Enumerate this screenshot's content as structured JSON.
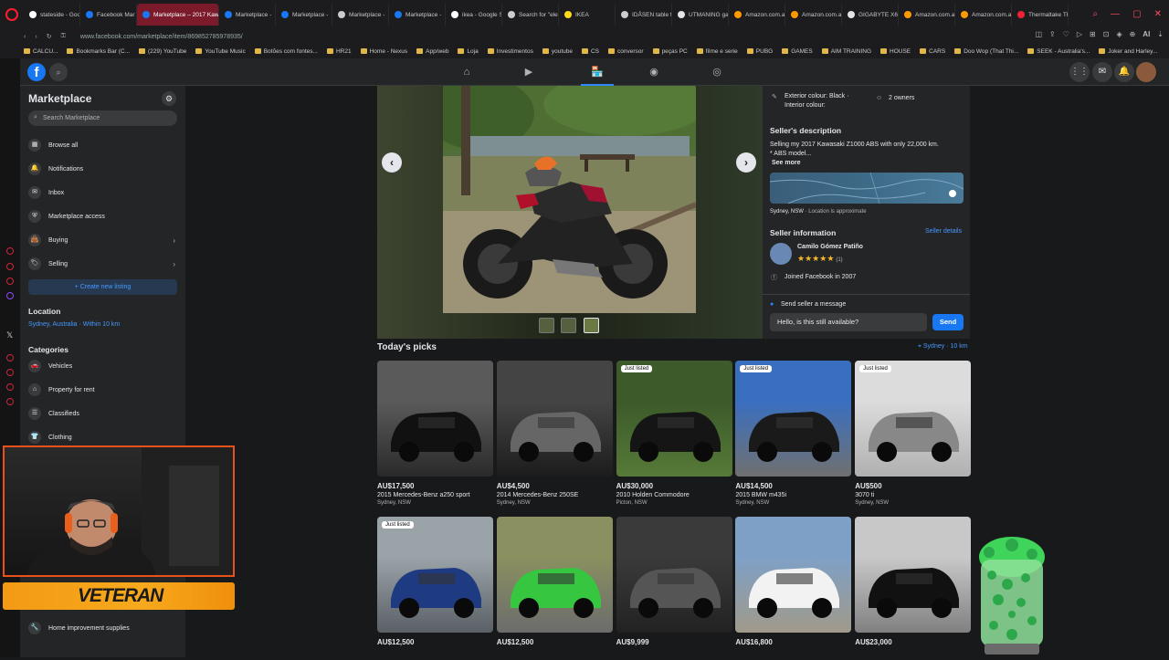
{
  "browser": {
    "tabs": [
      {
        "label": "stateside - Goo",
        "fav": "g"
      },
      {
        "label": "Facebook Mar",
        "fav": "fb"
      },
      {
        "label": "Marketplace – 2017 Kawa",
        "fav": "fb",
        "active": true
      },
      {
        "label": "Marketplace -",
        "fav": "fb"
      },
      {
        "label": "Marketplace -",
        "fav": "fb"
      },
      {
        "label": "Marketplace -",
        "fav": "doc"
      },
      {
        "label": "Marketplace -",
        "fav": "fb"
      },
      {
        "label": "ikea - Google S",
        "fav": "g"
      },
      {
        "label": "Search for \"ele",
        "fav": "doc"
      },
      {
        "label": "IKEA",
        "fav": "ikea"
      },
      {
        "label": "IDÅSEN table f",
        "fav": "doc"
      },
      {
        "label": "UTMANING ga",
        "fav": "ut"
      },
      {
        "label": "Amazon.com.a",
        "fav": "amz"
      },
      {
        "label": "Amazon.com.a",
        "fav": "amz"
      },
      {
        "label": "GIGABYTE X6",
        "fav": "ut"
      },
      {
        "label": "Amazon.com.a",
        "fav": "amz"
      },
      {
        "label": "Amazon.com.a",
        "fav": "amz"
      },
      {
        "label": "Thermaltake Th",
        "fav": "tt"
      }
    ],
    "url": "www.facebook.com/marketplace/item/869852785978935/",
    "ai_label": "AI",
    "bookmarks": [
      "CALCU...",
      "Bookmarks Bar (C...",
      "(229) YouTube",
      "YouTube Music",
      "Botões com fontes...",
      "HR21",
      "Home - Nexus",
      "App/web",
      "Loja",
      "Investimentos",
      "youtube",
      "CS",
      "conversor",
      "peças PC",
      "filme e serie",
      "PUBG",
      "GAMES",
      "AIM TRAINING",
      "HOUSE",
      "CARS",
      "Doo Wop (That Thi...",
      "SEEK - Australia's...",
      "Joker and Harley..."
    ]
  },
  "fb": {
    "logo": "f",
    "sidebar": {
      "title": "Marketplace",
      "search_placeholder": "Search Marketplace",
      "items": [
        {
          "label": "Browse all",
          "icon": "store-icon"
        },
        {
          "label": "Notifications",
          "icon": "bell-icon"
        },
        {
          "label": "Inbox",
          "icon": "inbox-icon"
        },
        {
          "label": "Marketplace access",
          "icon": "shield-icon"
        },
        {
          "label": "Buying",
          "icon": "bag-icon",
          "chevron": true
        },
        {
          "label": "Selling",
          "icon": "tag-icon",
          "chevron": true
        }
      ],
      "create_button": "+ Create new listing",
      "location_heading": "Location",
      "location_value": "Sydney, Australia · Within 10 km",
      "categories_heading": "Categories",
      "categories": [
        {
          "label": "Vehicles",
          "icon": "car-icon"
        },
        {
          "label": "Property for rent",
          "icon": "house-icon"
        },
        {
          "label": "Classifieds",
          "icon": "classifieds-icon"
        },
        {
          "label": "Clothing",
          "icon": "shirt-icon"
        }
      ],
      "bottom_category": "Home improvement supplies"
    },
    "details": {
      "exterior_colour": "Exterior colour: Black ·",
      "interior_colour": "Interior colour:",
      "owners": "2 owners",
      "description_heading": "Seller's description",
      "description_line1": "Selling my 2017 Kawasaki Z1000 ABS with only 22,000 km.",
      "description_line2": "* ABS model...",
      "see_more": "See more",
      "map_location": "Sydney, NSW",
      "map_note": " · Location is approximate",
      "seller_heading": "Seller information",
      "seller_details_link": "Seller details",
      "seller_name": "Camilo Gómez Patiño",
      "seller_rating": 5,
      "seller_rating_count": "(1)",
      "joined": "Joined Facebook in 2007",
      "send_message_label": "Send seller a message",
      "message_value": "Hello, is this still available?",
      "send_button": "Send"
    },
    "picks": {
      "heading": "Today's picks",
      "location": "Sydney · 10 km",
      "cards": [
        {
          "price": "AU$17,500",
          "title": "2015 Mercedes-Benz a250 sport",
          "location": "Sydney, NSW",
          "badge": "",
          "theme": "black-car-garage"
        },
        {
          "price": "AU$4,500",
          "title": "2014 Mercedes-Benz 250SE",
          "location": "Sydney, NSW",
          "badge": "",
          "theme": "car-interior"
        },
        {
          "price": "AU$30,000",
          "title": "2010 Holden Commodore",
          "location": "Picton, NSW",
          "badge": "Just listed",
          "theme": "black-car-grass"
        },
        {
          "price": "AU$14,500",
          "title": "2015 BMW m435i",
          "location": "Sydney, NSW",
          "badge": "Just listed",
          "theme": "black-car-street"
        },
        {
          "price": "AU$500",
          "title": "3070 ti",
          "location": "Sydney, NSW",
          "badge": "Just listed",
          "theme": "pc-parts"
        },
        {
          "price": "AU$12,500",
          "title": "",
          "location": "",
          "badge": "Just listed",
          "theme": "motorbike-blue"
        },
        {
          "price": "AU$12,500",
          "title": "",
          "location": "",
          "badge": "",
          "theme": "green-car"
        },
        {
          "price": "AU$9,999",
          "title": "",
          "location": "",
          "badge": "",
          "theme": "dark-car-garage"
        },
        {
          "price": "AU$16,800",
          "title": "",
          "location": "",
          "badge": "",
          "theme": "white-car"
        },
        {
          "price": "AU$23,000",
          "title": "",
          "location": "",
          "badge": "",
          "theme": "black-car-rear"
        }
      ]
    }
  },
  "overlay": {
    "banner_text": "VETERAN"
  },
  "colors": {
    "accent": "#1877f2",
    "link": "#4599ff",
    "surface": "#242526",
    "background": "#18191a",
    "opera_red": "#ff1b2d",
    "banner_orange": "#f7a91d"
  }
}
